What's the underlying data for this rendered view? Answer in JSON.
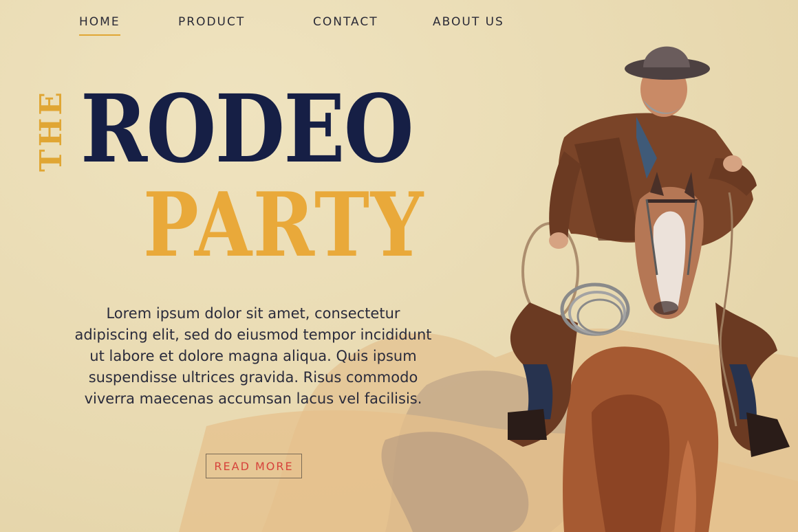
{
  "nav": {
    "items": [
      {
        "label": "HOME",
        "active": true
      },
      {
        "label": "PRODUCT",
        "active": false
      },
      {
        "label": "CONTACT",
        "active": false
      },
      {
        "label": "ABOUT US",
        "active": false
      }
    ]
  },
  "hero": {
    "the": "THE",
    "title_line1": "RODEO",
    "title_line2": "PARTY",
    "body": "Lorem ipsum dolor sit amet, consectetur adipiscing elit, sed do eiusmod tempor incididunt ut labore et dolore magna aliqua. Quis ipsum suspendisse ultrices gravida. Risus commodo viverra maecenas accumsan lacus vel facilisis.",
    "button_label": "READ MORE"
  },
  "colors": {
    "background": "#eadcb4",
    "navy": "#161f45",
    "gold": "#e0a634",
    "button_text": "#d6433b"
  },
  "illustration": {
    "subject": "cowboy-on-horse-illustration"
  }
}
